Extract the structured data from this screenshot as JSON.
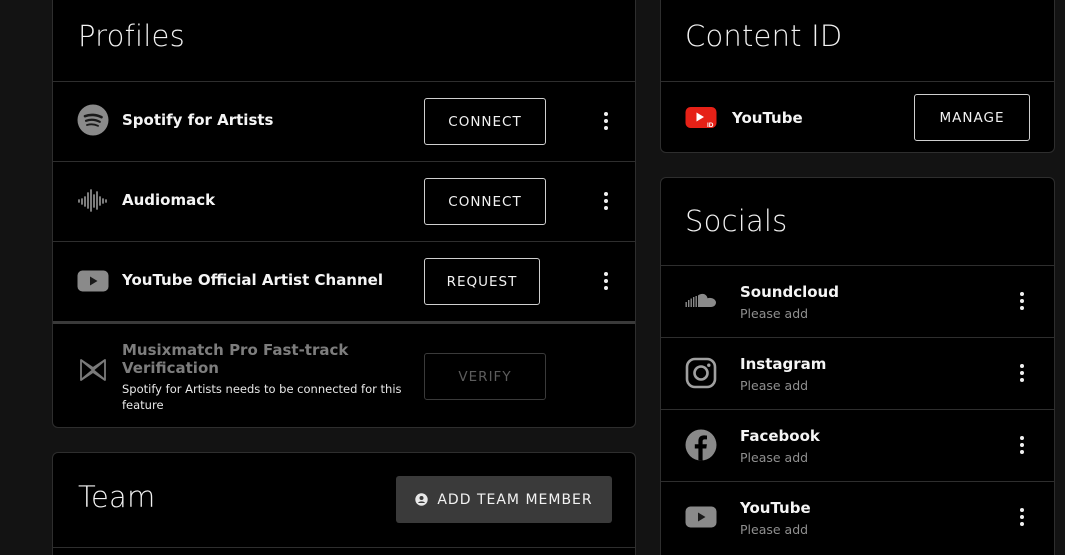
{
  "profiles": {
    "title": "Profiles",
    "items": [
      {
        "name": "Spotify for Artists",
        "button": "CONNECT",
        "icon": "spotify-icon"
      },
      {
        "name": "Audiomack",
        "button": "CONNECT",
        "icon": "audiomack-icon"
      },
      {
        "name": "YouTube Official Artist Channel",
        "button": "REQUEST",
        "icon": "youtube-icon"
      }
    ],
    "musixmatch": {
      "name": "Musixmatch Pro Fast-track Verification",
      "note": "Spotify for Artists needs to be connected for this feature",
      "button": "VERIFY",
      "icon": "musixmatch-icon"
    }
  },
  "content_id": {
    "title": "Content ID",
    "item": {
      "name": "YouTube",
      "button": "MANAGE",
      "icon": "youtube-content-id-icon"
    }
  },
  "socials": {
    "title": "Socials",
    "items": [
      {
        "name": "Soundcloud",
        "status": "Please add",
        "icon": "soundcloud-icon"
      },
      {
        "name": "Instagram",
        "status": "Please add",
        "icon": "instagram-icon"
      },
      {
        "name": "Facebook",
        "status": "Please add",
        "icon": "facebook-icon"
      },
      {
        "name": "YouTube",
        "status": "Please add",
        "icon": "youtube-icon"
      }
    ]
  },
  "team": {
    "title": "Team",
    "add_button": "ADD TEAM MEMBER"
  },
  "colors": {
    "page_bg": "#131313",
    "card_bg": "#000000",
    "border": "#2e2e2e",
    "youtube_red": "#e62117",
    "muted_text": "#8f8f8f",
    "add_button_bg": "#3a3a3a"
  }
}
